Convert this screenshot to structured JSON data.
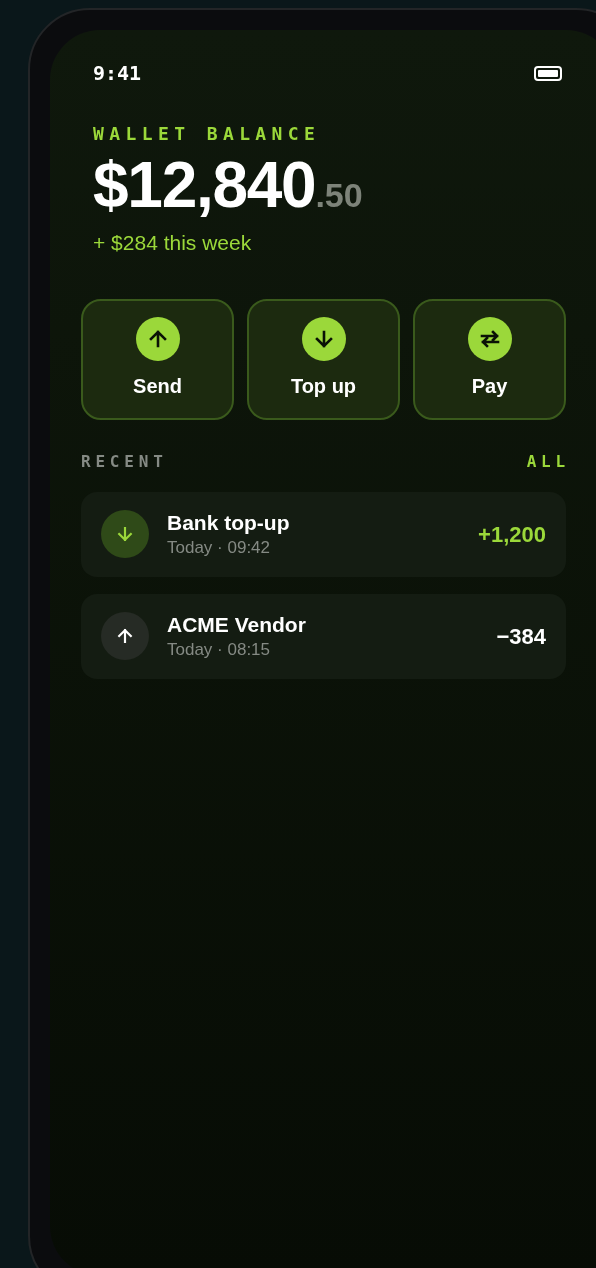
{
  "status_bar": {
    "time": "9:41"
  },
  "balance": {
    "label": "WALLET BALANCE",
    "whole": "$12,840",
    "cents": ".50",
    "change": "+ $284 this week"
  },
  "actions": [
    {
      "label": "Send",
      "kind": "up"
    },
    {
      "label": "Top up",
      "kind": "down"
    },
    {
      "label": "Pay",
      "kind": "swap"
    }
  ],
  "recent": {
    "title": "RECENT",
    "link": "ALL",
    "transactions": [
      {
        "name": "Bank top-up",
        "time": "Today · 09:42",
        "amount": "+1,200",
        "kind": "in"
      },
      {
        "name": "ACME Vendor",
        "time": "Today · 08:15",
        "amount": "−384",
        "kind": "out"
      }
    ]
  }
}
